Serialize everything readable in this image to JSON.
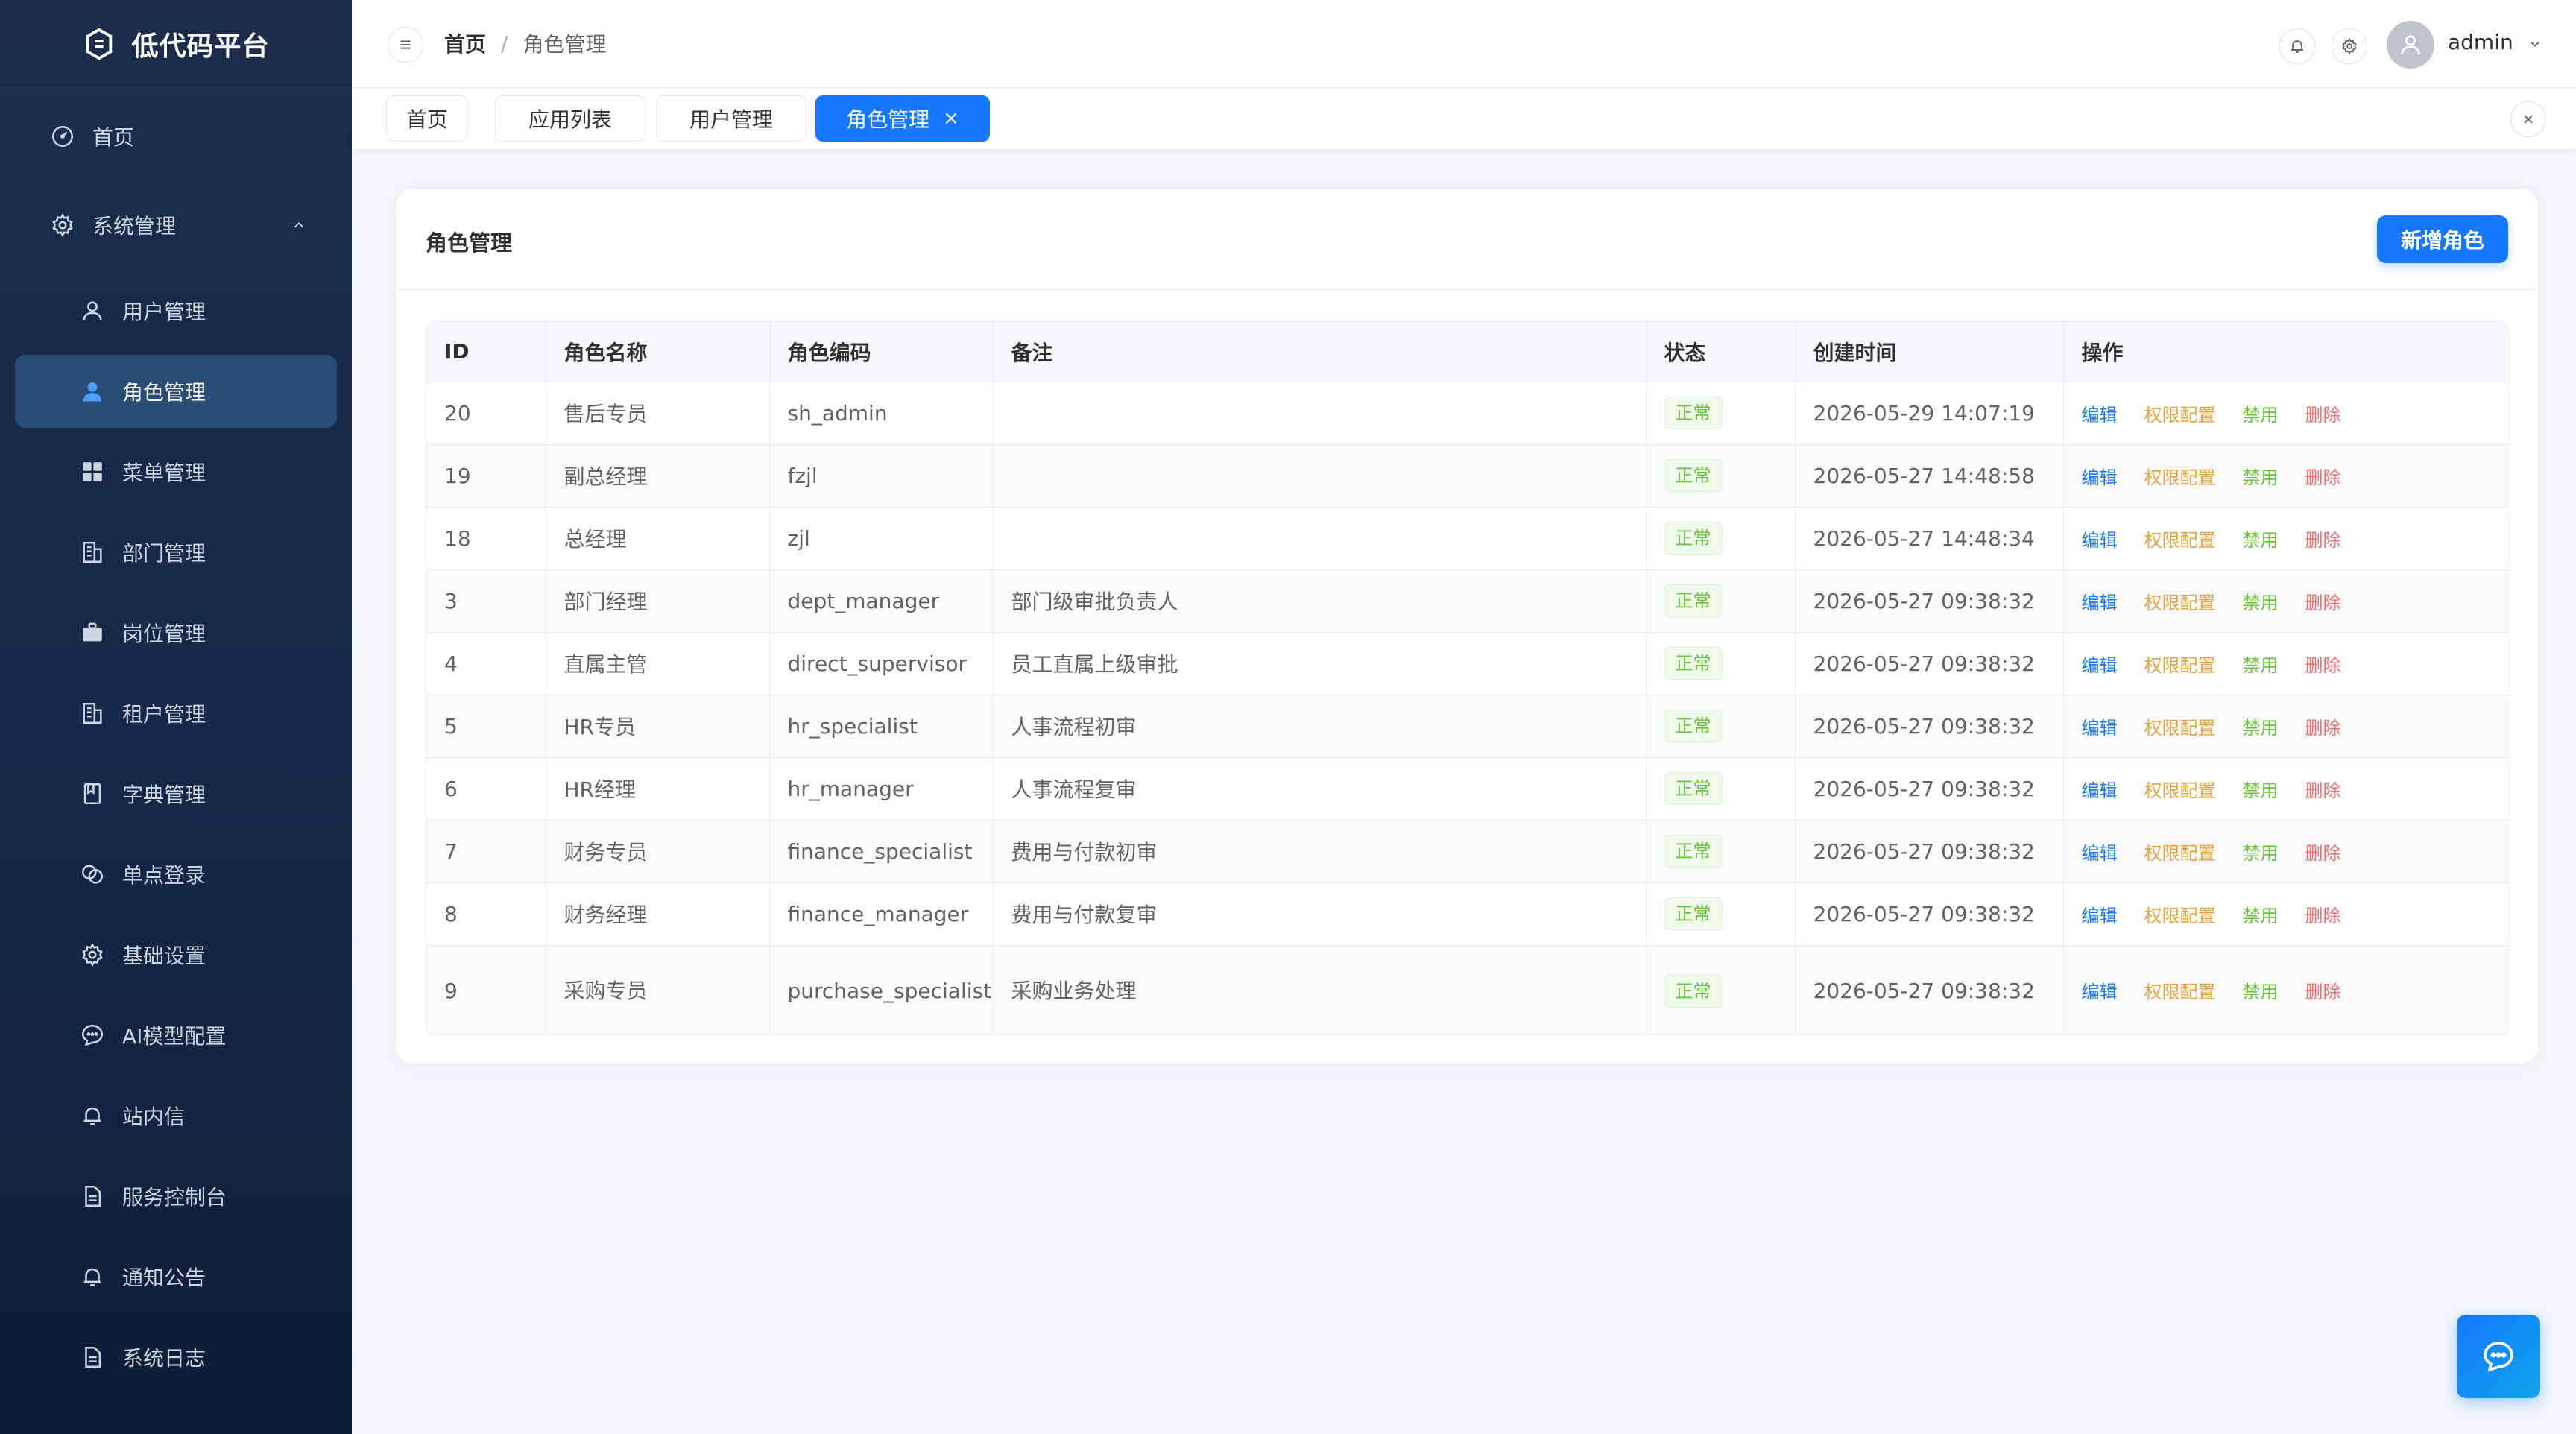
{
  "app": {
    "title": "低代码平台"
  },
  "sidebar": {
    "items": [
      {
        "label": "首页",
        "icon": "dashboard-icon"
      },
      {
        "label": "系统管理",
        "icon": "gear-icon"
      },
      {
        "label": "用户管理",
        "icon": "user-icon"
      },
      {
        "label": "角色管理",
        "icon": "user-filled-icon",
        "active": true
      },
      {
        "label": "菜单管理",
        "icon": "grid-icon"
      },
      {
        "label": "部门管理",
        "icon": "building-icon"
      },
      {
        "label": "岗位管理",
        "icon": "briefcase-icon"
      },
      {
        "label": "租户管理",
        "icon": "building-icon"
      },
      {
        "label": "字典管理",
        "icon": "book-icon"
      },
      {
        "label": "单点登录",
        "icon": "link-icon"
      },
      {
        "label": "基础设置",
        "icon": "gear-icon"
      },
      {
        "label": "AI模型配置",
        "icon": "chat-icon"
      },
      {
        "label": "站内信",
        "icon": "bell-icon"
      },
      {
        "label": "服务控制台",
        "icon": "document-icon"
      },
      {
        "label": "通知公告",
        "icon": "bell-icon"
      },
      {
        "label": "系统日志",
        "icon": "document-icon"
      }
    ]
  },
  "header": {
    "breadcrumb": {
      "home": "首页",
      "separator": "/",
      "current": "角色管理"
    },
    "username": "admin"
  },
  "tabs": [
    {
      "label": "首页"
    },
    {
      "label": "应用列表"
    },
    {
      "label": "用户管理"
    },
    {
      "label": "角色管理",
      "active": true,
      "close": "×"
    }
  ],
  "card": {
    "title": "角色管理",
    "add_button": "新增角色"
  },
  "table": {
    "columns": [
      "ID",
      "角色名称",
      "角色编码",
      "备注",
      "状态",
      "创建时间",
      "操作"
    ],
    "rows": [
      {
        "id": "20",
        "name": "售后专员",
        "code": "sh_admin",
        "remark": "",
        "status": "正常",
        "created": "2026-05-29 14:07:19"
      },
      {
        "id": "19",
        "name": "副总经理",
        "code": "fzjl",
        "remark": "",
        "status": "正常",
        "created": "2026-05-27 14:48:58"
      },
      {
        "id": "18",
        "name": "总经理",
        "code": "zjl",
        "remark": "",
        "status": "正常",
        "created": "2026-05-27 14:48:34"
      },
      {
        "id": "3",
        "name": "部门经理",
        "code": "dept_manager",
        "remark": "部门级审批负责人",
        "status": "正常",
        "created": "2026-05-27 09:38:32"
      },
      {
        "id": "4",
        "name": "直属主管",
        "code": "direct_supervisor",
        "remark": "员工直属上级审批",
        "status": "正常",
        "created": "2026-05-27 09:38:32"
      },
      {
        "id": "5",
        "name": "HR专员",
        "code": "hr_specialist",
        "remark": "人事流程初审",
        "status": "正常",
        "created": "2026-05-27 09:38:32"
      },
      {
        "id": "6",
        "name": "HR经理",
        "code": "hr_manager",
        "remark": "人事流程复审",
        "status": "正常",
        "created": "2026-05-27 09:38:32"
      },
      {
        "id": "7",
        "name": "财务专员",
        "code": "finance_specialist",
        "remark": "费用与付款初审",
        "status": "正常",
        "created": "2026-05-27 09:38:32"
      },
      {
        "id": "8",
        "name": "财务经理",
        "code": "finance_manager",
        "remark": "费用与付款复审",
        "status": "正常",
        "created": "2026-05-27 09:38:32"
      },
      {
        "id": "9",
        "name": "采购专员",
        "code": "purchase_specialist",
        "remark": "采购业务处理",
        "status": "正常",
        "created": "2026-05-27 09:38:32"
      }
    ],
    "actions": {
      "edit": "编辑",
      "permissions": "权限配置",
      "disable": "禁用",
      "delete": "删除"
    }
  },
  "colors": {
    "primary": "#1677ff",
    "sidebar_bg": "#16294a",
    "status_ok": "#67c23a",
    "warning": "#e6a23c",
    "danger": "#f56c6c"
  }
}
